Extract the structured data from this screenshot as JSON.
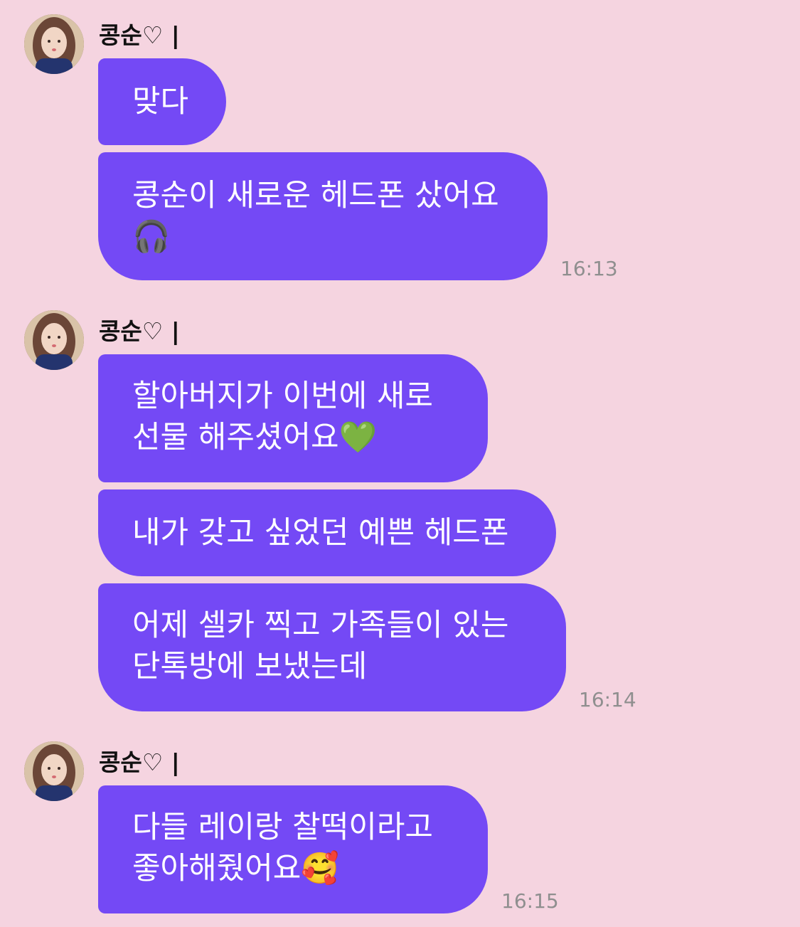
{
  "groups": [
    {
      "sender": "콩순♡ |",
      "time": "16:13",
      "bubbles": [
        {
          "lines": [
            "맞다"
          ]
        },
        {
          "lines": [
            "콩순이 새로운 헤드폰 샀어요",
            "🎧"
          ]
        }
      ]
    },
    {
      "sender": "콩순♡ |",
      "time": "16:14",
      "bubbles": [
        {
          "lines": [
            "할아버지가 이번에 새로",
            "선물 해주셨어요💚"
          ]
        },
        {
          "lines": [
            "내가 갖고 싶었던 예쁜 헤드폰"
          ]
        },
        {
          "lines": [
            "어제 셀카 찍고 가족들이 있는",
            "단톡방에 보냈는데"
          ]
        }
      ]
    },
    {
      "sender": "콩순♡ |",
      "time": "16:15",
      "bubbles": [
        {
          "lines": [
            "다들 레이랑 찰떡이라고",
            "좋아해줬어요🥰"
          ]
        }
      ]
    }
  ],
  "colors": {
    "background": "#f5d4e0",
    "bubble": "#7449f5",
    "bubble_text": "#ffffff",
    "timestamp": "#8f8f8f"
  },
  "icons": {
    "avatar": "profile-photo"
  }
}
